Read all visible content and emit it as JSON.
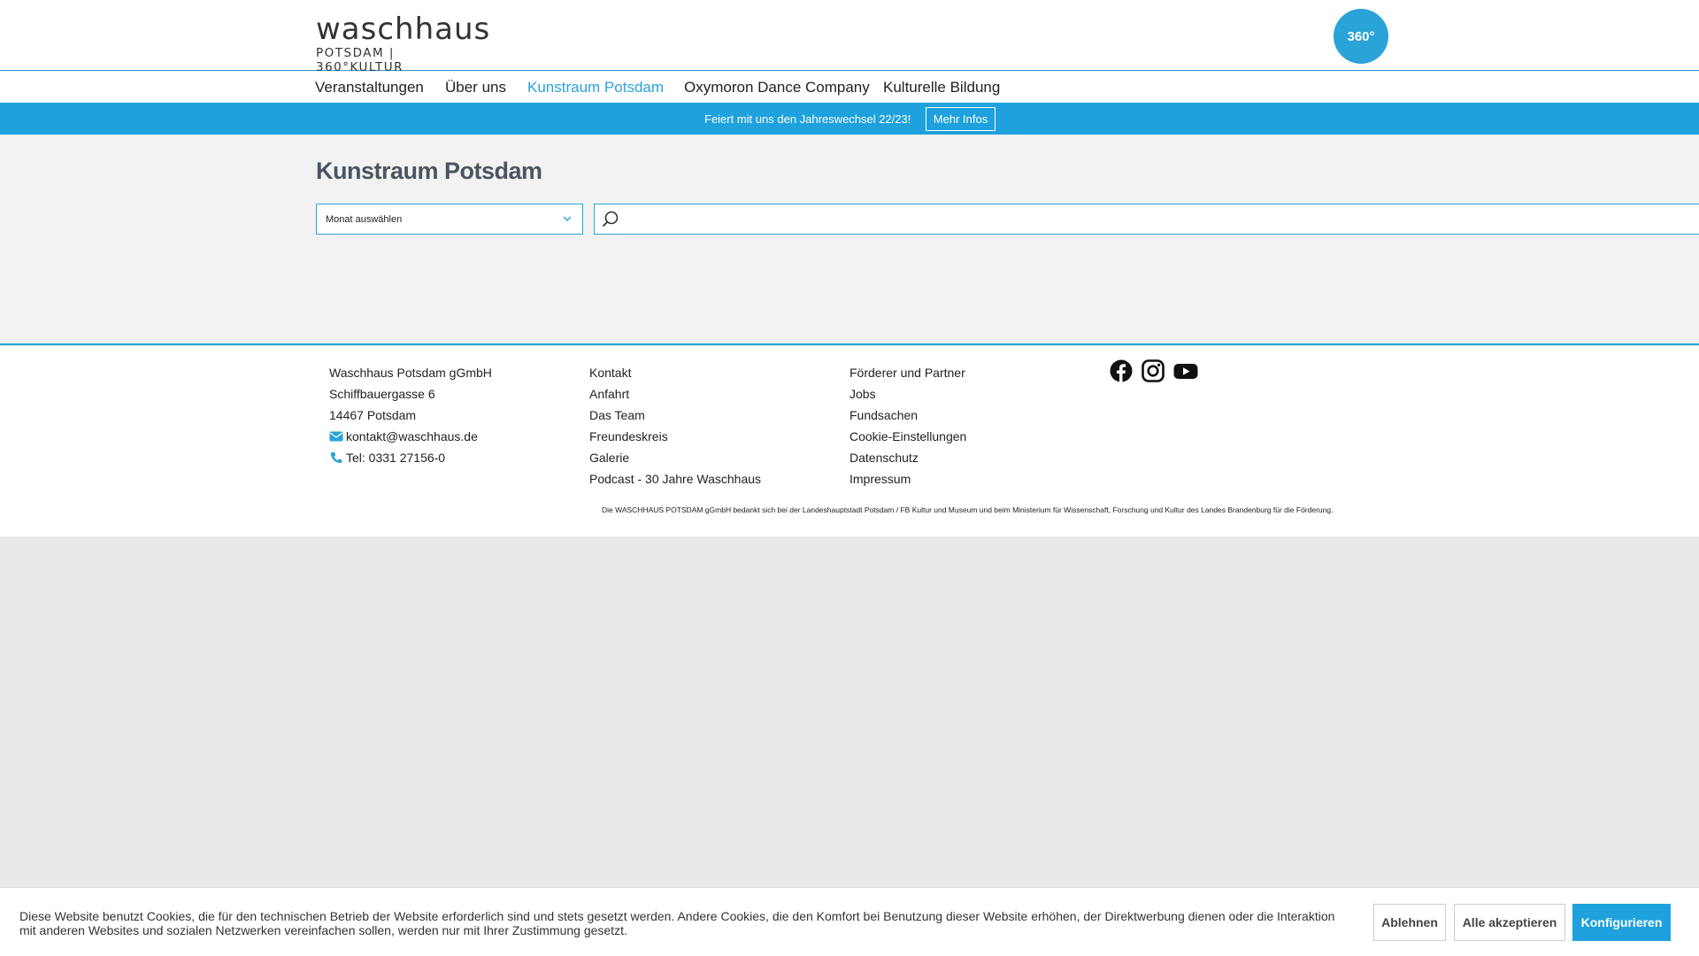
{
  "header": {
    "logo_word": "waschhaus",
    "logo_sub": "POTSDAM | 360°KULTUR",
    "badge": "360°"
  },
  "nav": {
    "items": [
      {
        "label": "Veranstaltungen"
      },
      {
        "label": "Über uns"
      },
      {
        "label": "Kunstraum Potsdam"
      },
      {
        "label": "Oxymoron Dance Company"
      },
      {
        "label": "Kulturelle Bildung"
      }
    ],
    "active": "Kunstraum Potsdam"
  },
  "promo": {
    "text": "Feiert mit uns den Jahreswechsel 22/23!",
    "button": "Mehr Infos"
  },
  "main": {
    "title": "Kunstraum Potsdam",
    "month_select": "Monat auswählen",
    "search_placeholder": ""
  },
  "footer": {
    "address": {
      "name": "Waschhaus Potsdam gGmbH",
      "street": "Schiffbauergasse 6",
      "city": "14467 Potsdam",
      "email": "kontakt@waschhaus.de",
      "phone": "Tel: 0331 27156-0"
    },
    "links1": [
      "Kontakt",
      "Anfahrt",
      "Das Team",
      "Freundeskreis",
      "Galerie",
      "Podcast - 30 Jahre Waschhaus"
    ],
    "links2": [
      "Förderer und Partner",
      "Jobs",
      "Fundsachen",
      "Cookie-Einstellungen",
      "Datenschutz",
      "Impressum"
    ],
    "social": [
      "facebook-icon",
      "instagram-icon",
      "youtube-icon"
    ],
    "thanks": "Die WASCHHAUS POTSDAM gGmbH bedankt sich bei der Landeshauptstadt Potsdam / FB Kultur und Museum und beim Ministerium für Wissenschaft, Forschung und Kultur des Landes Brandenburg für die Förderung."
  },
  "cookie": {
    "message": "Diese Website benutzt Cookies, die für den technischen Betrieb der Website erforderlich sind und stets gesetzt werden. Andere Cookies, die den Komfort bei Benutzung dieser Website erhöhen, der Direktwerbung dienen oder die Interaktion mit anderen Websites und sozialen Netzwerken vereinfachen sollen, werden nur mit Ihrer Zustimmung gesetzt.",
    "decline": "Ablehnen",
    "accept_all": "Alle akzeptieren",
    "configure": "Konfigurieren"
  },
  "colors": {
    "accent": "#1ea1dc",
    "title": "#4a5560"
  }
}
